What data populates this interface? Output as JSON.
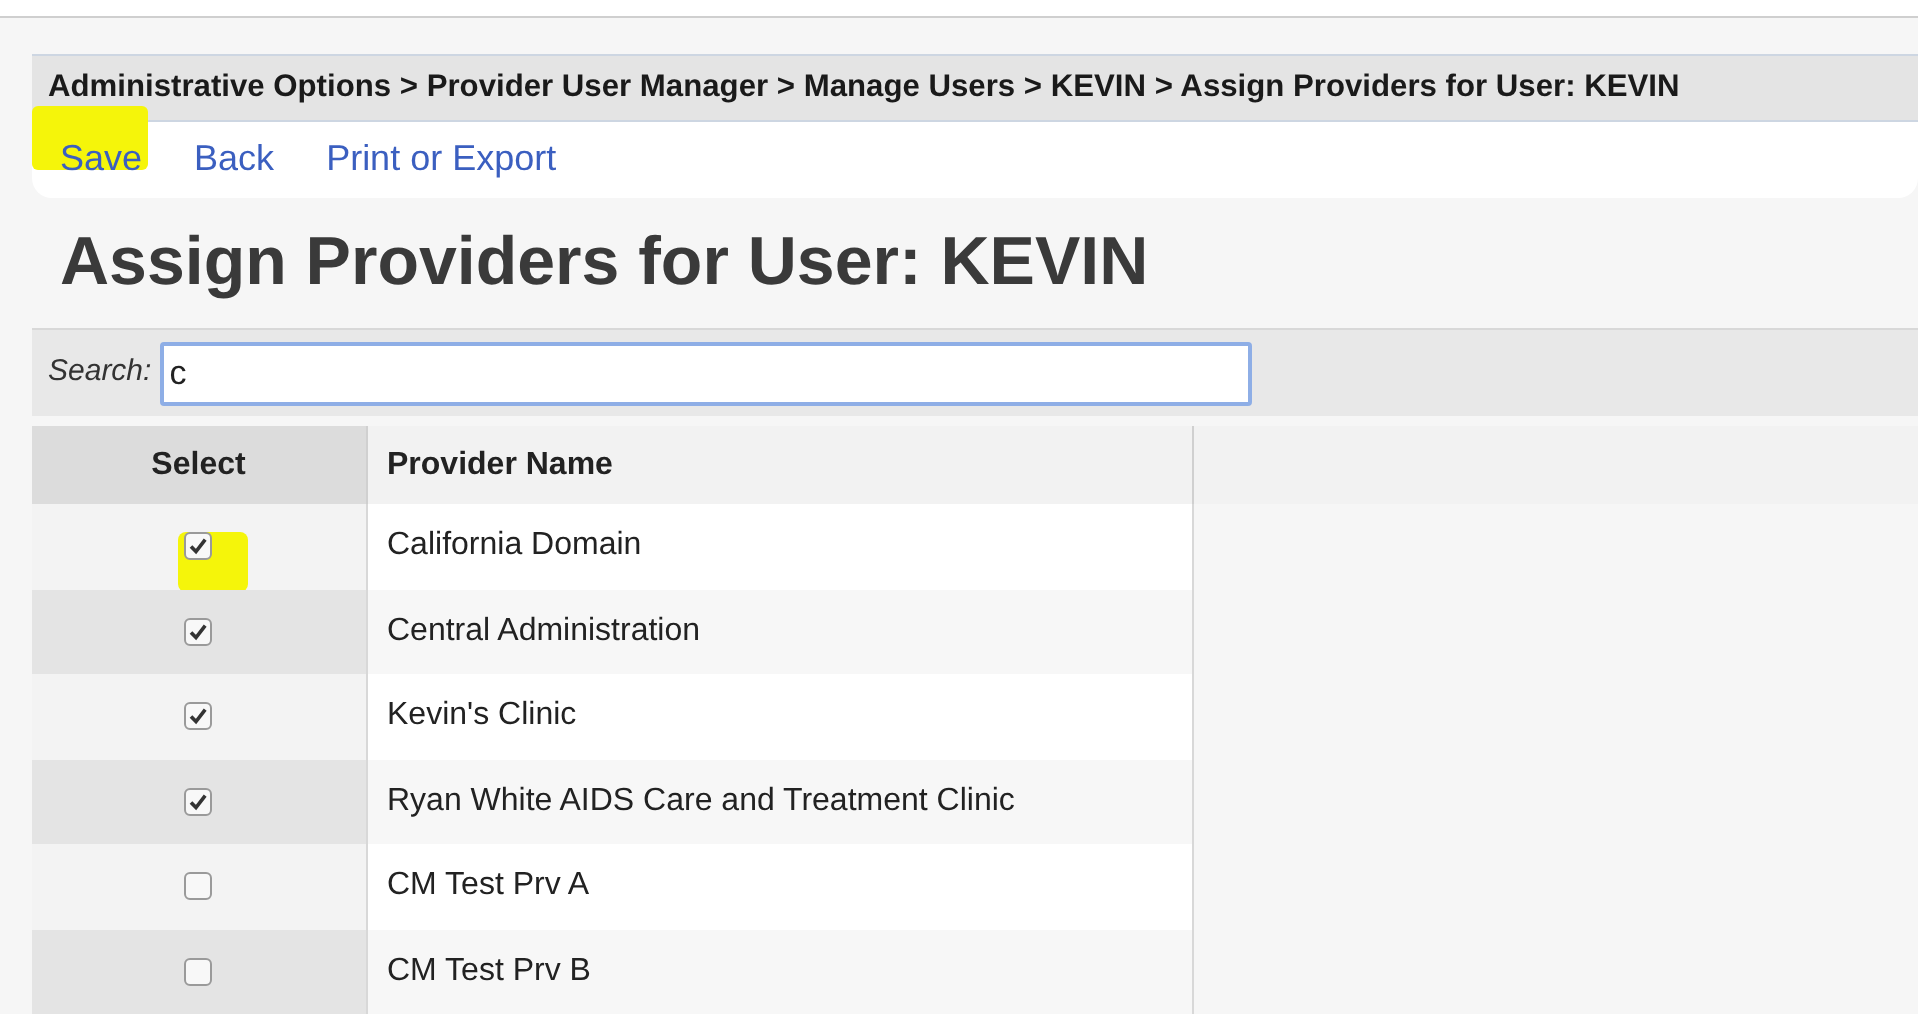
{
  "breadcrumb": "Administrative Options > Provider User Manager > Manage Users > KEVIN > Assign Providers for User: KEVIN",
  "actions": [
    "Save",
    "Back",
    "Print or Export"
  ],
  "title": "Assign Providers for User: KEVIN",
  "search": {
    "label": "Search:",
    "value": "c"
  },
  "table": {
    "columns": [
      "Select",
      "Provider Name"
    ],
    "rows": [
      {
        "checked": true,
        "name": "California Domain"
      },
      {
        "checked": true,
        "name": "Central Administration"
      },
      {
        "checked": true,
        "name": "Kevin's Clinic"
      },
      {
        "checked": true,
        "name": "Ryan White AIDS Care and Treatment Clinic"
      },
      {
        "checked": false,
        "name": "CM Test Prv A"
      },
      {
        "checked": false,
        "name": "CM Test Prv B"
      }
    ]
  }
}
